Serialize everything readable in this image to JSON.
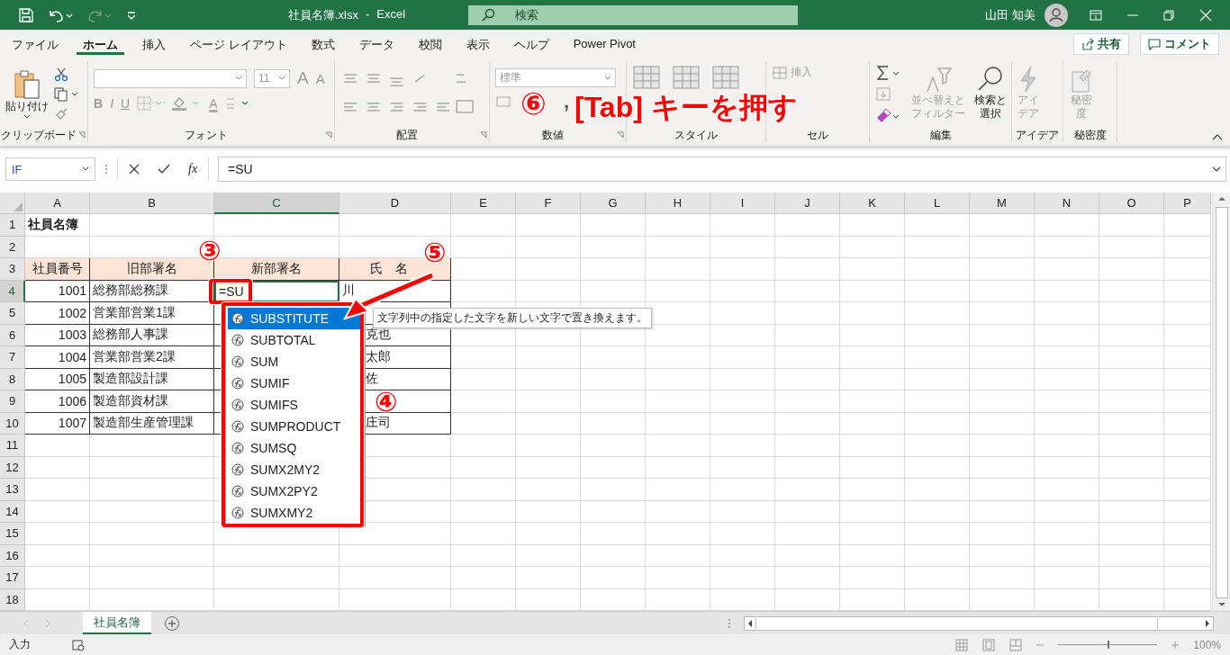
{
  "title_bar": {
    "filename": "社員名簿.xlsx",
    "separator": "-",
    "app": "Excel",
    "search_placeholder": "検索",
    "user": "山田 知美"
  },
  "menu_tabs": [
    {
      "label": "ファイル",
      "selected": false
    },
    {
      "label": "ホーム",
      "selected": true
    },
    {
      "label": "挿入",
      "selected": false
    },
    {
      "label": "ページ レイアウト",
      "selected": false
    },
    {
      "label": "数式",
      "selected": false
    },
    {
      "label": "データ",
      "selected": false
    },
    {
      "label": "校閲",
      "selected": false
    },
    {
      "label": "表示",
      "selected": false
    },
    {
      "label": "ヘルプ",
      "selected": false
    },
    {
      "label": "Power Pivot",
      "selected": false
    }
  ],
  "share_button": "共有",
  "comment_button": "コメント",
  "ribbon": {
    "clipboard": {
      "paste": "貼り付け",
      "label": "クリップボード"
    },
    "font": {
      "size": "11",
      "grow": "A",
      "shrink": "A",
      "bold": "B",
      "italic": "I",
      "underline": "U",
      "font_color": "A",
      "label": "フォント"
    },
    "alignment": {
      "label": "配置"
    },
    "number": {
      "format": "標準",
      "comma_style": ",",
      "label": "数値"
    },
    "styles": {
      "label": "スタイル"
    },
    "cells": {
      "insert": "挿入",
      "label": "セル"
    },
    "editing": {
      "sort": [
        "並べ替えと",
        "フィルター"
      ],
      "find": [
        "検索と",
        "選択"
      ],
      "label": "編集"
    },
    "ideas": {
      "button": [
        "アイ",
        "デア"
      ],
      "label": "アイデア"
    },
    "sensitivity": {
      "button": [
        "秘密",
        "度"
      ],
      "label": "秘密度"
    }
  },
  "formula_bar": {
    "name_box": "IF",
    "fx": "fx",
    "formula": "=SU"
  },
  "columns": [
    {
      "label": "A",
      "selected": false
    },
    {
      "label": "B",
      "selected": false
    },
    {
      "label": "C",
      "selected": true
    },
    {
      "label": "D",
      "selected": false
    },
    {
      "label": "E",
      "selected": false
    },
    {
      "label": "F",
      "selected": false
    },
    {
      "label": "G",
      "selected": false
    },
    {
      "label": "H",
      "selected": false
    },
    {
      "label": "I",
      "selected": false
    },
    {
      "label": "J",
      "selected": false
    },
    {
      "label": "K",
      "selected": false
    },
    {
      "label": "L",
      "selected": false
    },
    {
      "label": "M",
      "selected": false
    },
    {
      "label": "N",
      "selected": false
    },
    {
      "label": "O",
      "selected": false
    },
    {
      "label": "P",
      "selected": false
    }
  ],
  "rows": [
    {
      "number": "1",
      "selected": false,
      "kind": "title",
      "title": "社員名簿"
    },
    {
      "number": "2",
      "selected": false,
      "kind": "empty"
    },
    {
      "number": "3",
      "selected": false,
      "kind": "header",
      "headers": [
        "社員番号",
        "旧部署名",
        "新部署名",
        "氏　名"
      ]
    },
    {
      "number": "4",
      "selected": true,
      "kind": "record",
      "employee_no": "1001",
      "old_department": "総務部総務課",
      "new_department": "=SU",
      "name": "川"
    },
    {
      "number": "5",
      "selected": false,
      "kind": "record",
      "employee_no": "1002",
      "old_department": "営業部営業1課"
    },
    {
      "number": "6",
      "selected": false,
      "kind": "record",
      "employee_no": "1003",
      "old_department": "総務部人事課",
      "name": "克也"
    },
    {
      "number": "7",
      "selected": false,
      "kind": "record",
      "employee_no": "1004",
      "old_department": "営業部営業2課",
      "name": "太郎"
    },
    {
      "number": "8",
      "selected": false,
      "kind": "record",
      "employee_no": "1005",
      "old_department": "製造部設計課",
      "name": "佐"
    },
    {
      "number": "9",
      "selected": false,
      "kind": "record",
      "employee_no": "1006",
      "old_department": "製造部資材課"
    },
    {
      "number": "10",
      "selected": false,
      "kind": "record",
      "employee_no": "1007",
      "old_department": "製造部生産管理課",
      "name": "庄司"
    },
    {
      "number": "11",
      "selected": false,
      "kind": "empty"
    },
    {
      "number": "12",
      "selected": false,
      "kind": "empty"
    },
    {
      "number": "13",
      "selected": false,
      "kind": "empty"
    },
    {
      "number": "14",
      "selected": false,
      "kind": "empty"
    },
    {
      "number": "15",
      "selected": false,
      "kind": "empty"
    },
    {
      "number": "16",
      "selected": false,
      "kind": "empty"
    },
    {
      "number": "17",
      "selected": false,
      "kind": "empty"
    },
    {
      "number": "18",
      "selected": false,
      "kind": "empty"
    }
  ],
  "autocomplete": {
    "items": [
      {
        "label": "SUBSTITUTE",
        "selected": true
      },
      {
        "label": "SUBTOTAL",
        "selected": false
      },
      {
        "label": "SUM",
        "selected": false
      },
      {
        "label": "SUMIF",
        "selected": false
      },
      {
        "label": "SUMIFS",
        "selected": false
      },
      {
        "label": "SUMPRODUCT",
        "selected": false
      },
      {
        "label": "SUMSQ",
        "selected": false
      },
      {
        "label": "SUMX2MY2",
        "selected": false
      },
      {
        "label": "SUMX2PY2",
        "selected": false
      },
      {
        "label": "SUMXMY2",
        "selected": false
      }
    ],
    "tooltip": "文字列中の指定した文字を新しい文字で置き換えます。"
  },
  "annotations": {
    "step_cell": "③",
    "step_list": "④",
    "step_arrow": "⑤",
    "step_key": "⑥",
    "instruction": "[Tab] キーを押す"
  },
  "sheet_tabs": [
    {
      "label": "社員名簿",
      "selected": true
    }
  ],
  "status_bar": {
    "mode": "入力",
    "zoom": "100%",
    "zoom_level": {
      "level": 0.5
    }
  }
}
